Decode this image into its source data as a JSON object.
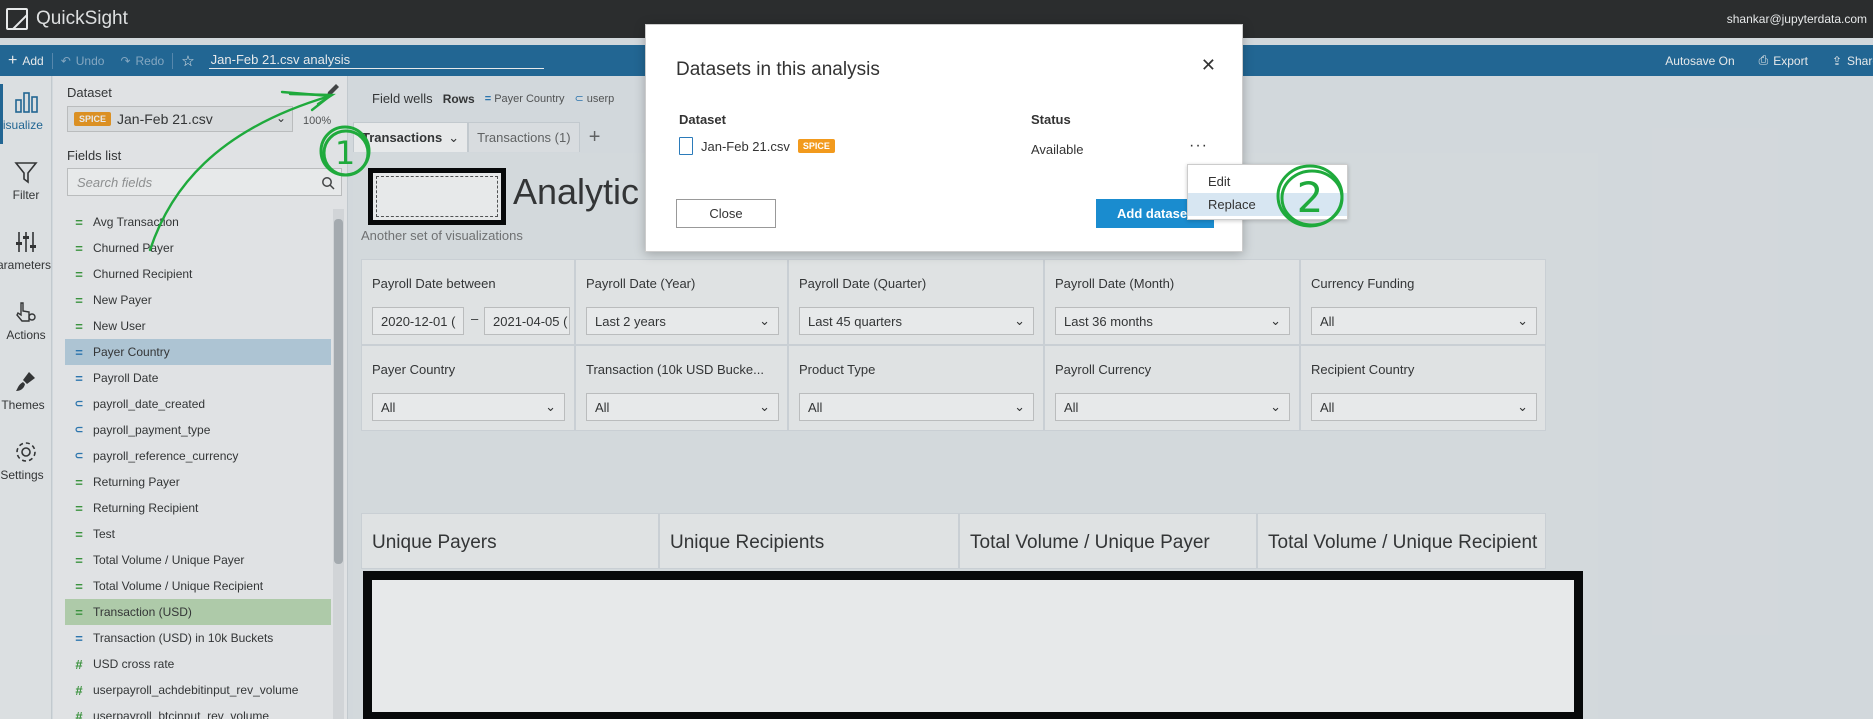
{
  "app": {
    "name": "QuickSight",
    "user": "shankar@jupyterdata.com"
  },
  "toolbar": {
    "add": "Add",
    "undo": "Undo",
    "redo": "Redo",
    "analysis_title": "Jan-Feb 21.csv analysis",
    "autosave": "Autosave On",
    "export": "Export",
    "share": "Share"
  },
  "leftnav": [
    "Visualize",
    "Filter",
    "Parameters",
    "Actions",
    "Themes",
    "Settings"
  ],
  "fieldpanel": {
    "dataset_label": "Dataset",
    "dataset_badge": "SPICE",
    "dataset_name": "Jan-Feb 21.csv",
    "percent": "100%",
    "fields_label": "Fields list",
    "search_placeholder": "Search fields",
    "fields": [
      {
        "name": "Avg Transaction",
        "icon": "measure"
      },
      {
        "name": "Churned Payer",
        "icon": "measure"
      },
      {
        "name": "Churned Recipient",
        "icon": "measure"
      },
      {
        "name": "New Payer",
        "icon": "measure"
      },
      {
        "name": "New User",
        "icon": "measure"
      },
      {
        "name": "Payer Country",
        "icon": "dim",
        "selected": "blue"
      },
      {
        "name": "Payroll Date",
        "icon": "dim"
      },
      {
        "name": "payroll_date_created",
        "icon": "tag"
      },
      {
        "name": "payroll_payment_type",
        "icon": "tag"
      },
      {
        "name": "payroll_reference_currency",
        "icon": "tag"
      },
      {
        "name": "Returning Payer",
        "icon": "measure"
      },
      {
        "name": "Returning Recipient",
        "icon": "measure"
      },
      {
        "name": "Test",
        "icon": "measure"
      },
      {
        "name": "Total Volume / Unique Payer",
        "icon": "measure"
      },
      {
        "name": "Total Volume / Unique Recipient",
        "icon": "measure"
      },
      {
        "name": "Transaction (USD)",
        "icon": "measure",
        "selected": "green"
      },
      {
        "name": "Transaction (USD) in 10k Buckets",
        "icon": "dim"
      },
      {
        "name": "USD cross rate",
        "icon": "hash"
      },
      {
        "name": "userpayroll_achdebitinput_rev_volume",
        "icon": "hash"
      },
      {
        "name": "userpayroll_btcinput_rev_volume",
        "icon": "hash"
      }
    ]
  },
  "fieldwells": {
    "label": "Field wells",
    "rows_label": "Rows",
    "rows_value": "Payer Country",
    "extra": "userp"
  },
  "tabs": [
    "Transactions",
    "Transactions (1)"
  ],
  "sheet": {
    "title": "Analytic",
    "subtitle": "Another set of visualizations"
  },
  "controls": {
    "payroll_between": {
      "label": "Payroll Date between",
      "from": "2020-12-01 (",
      "sep": "–",
      "to": "2021-04-05 ("
    },
    "year": {
      "label": "Payroll Date (Year)",
      "value": "Last 2 years"
    },
    "quarter": {
      "label": "Payroll Date (Quarter)",
      "value": "Last 45 quarters"
    },
    "month": {
      "label": "Payroll Date (Month)",
      "value": "Last 36 months"
    },
    "currency_funding": {
      "label": "Currency Funding",
      "value": "All"
    },
    "payer_country": {
      "label": "Payer Country",
      "value": "All"
    },
    "transaction_bucket": {
      "label": "Transaction (10k USD Bucke...",
      "value": "All"
    },
    "product_type": {
      "label": "Product Type",
      "value": "All"
    },
    "payroll_currency": {
      "label": "Payroll Currency",
      "value": "All"
    },
    "recipient_country": {
      "label": "Recipient Country",
      "value": "All"
    }
  },
  "kpis": [
    "Unique Payers",
    "Unique Recipients",
    "Total Volume / Unique Payer",
    "Total Volume / Unique Recipient"
  ],
  "modal": {
    "title": "Datasets in this analysis",
    "col_dataset": "Dataset",
    "col_status": "Status",
    "dataset_name": "Jan-Feb 21.csv",
    "dataset_badge": "SPICE",
    "status": "Available",
    "more": "···",
    "close_button": "Close",
    "add_button": "Add datase"
  },
  "context_menu": {
    "edit": "Edit",
    "replace": "Replace"
  },
  "annotations": {
    "step1": "1",
    "step2": "2"
  },
  "colors": {
    "topbar": "#2a2a2a",
    "toolbar": "#1f6a9c",
    "spice": "#f29a1d",
    "primary_button": "#1a8ccf",
    "annotation": "#1faa3c"
  }
}
